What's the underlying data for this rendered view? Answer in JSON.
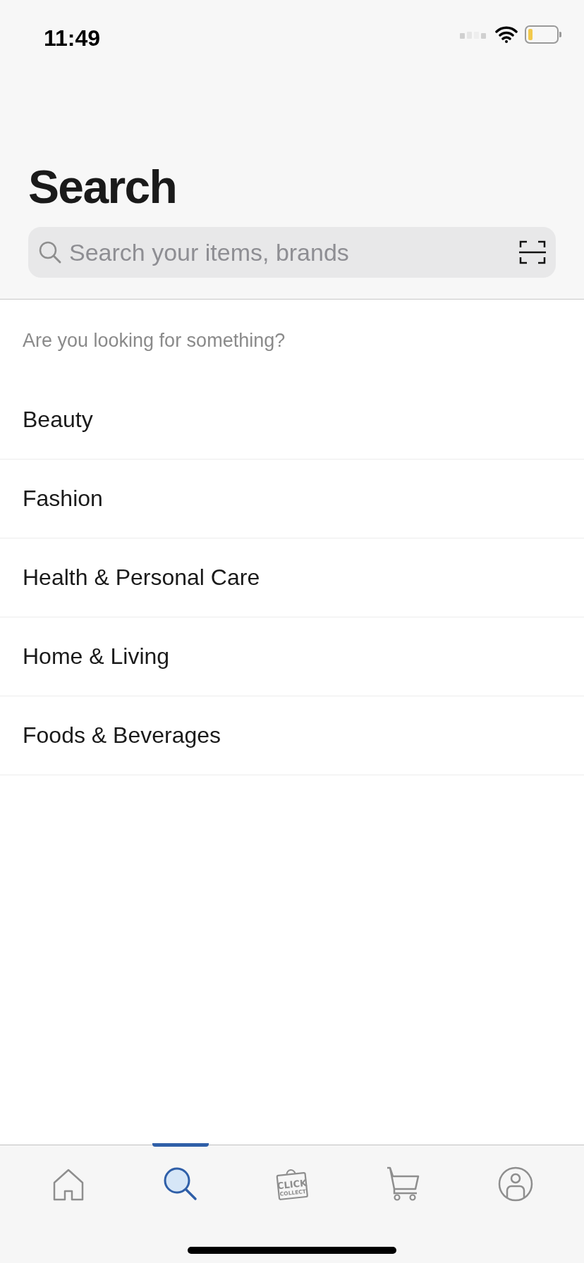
{
  "status_bar": {
    "time": "11:49"
  },
  "title": "Search",
  "search": {
    "placeholder": "Search your items, brands"
  },
  "prompt": "Are you looking for something?",
  "categories": [
    "Beauty",
    "Fashion",
    "Health & Personal Care",
    "Home & Living",
    "Foods & Beverages"
  ],
  "tabs": [
    {
      "kind": "home",
      "selected": false
    },
    {
      "kind": "search",
      "selected": true
    },
    {
      "kind": "click_collect",
      "selected": false,
      "lines": [
        "CLICK",
        "COLLECT"
      ]
    },
    {
      "kind": "cart",
      "selected": false
    },
    {
      "kind": "account",
      "selected": false
    }
  ]
}
